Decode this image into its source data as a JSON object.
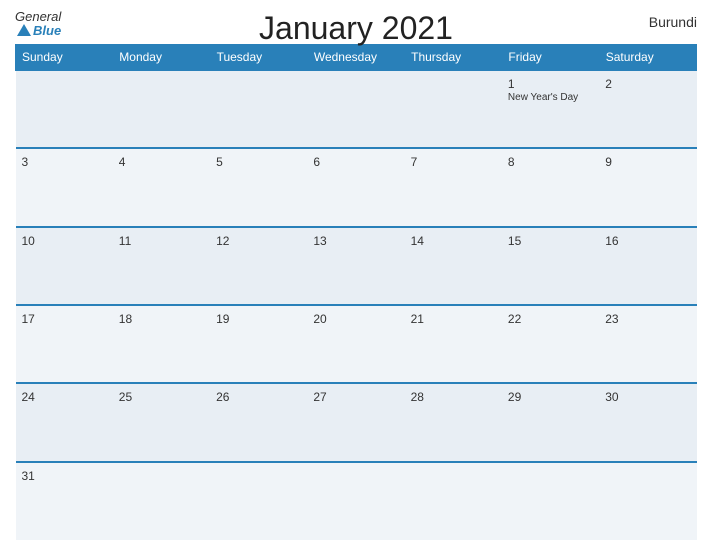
{
  "header": {
    "logo_general": "General",
    "logo_blue": "Blue",
    "title": "January 2021",
    "country": "Burundi"
  },
  "days_of_week": [
    "Sunday",
    "Monday",
    "Tuesday",
    "Wednesday",
    "Thursday",
    "Friday",
    "Saturday"
  ],
  "weeks": [
    [
      {
        "day": "",
        "event": ""
      },
      {
        "day": "",
        "event": ""
      },
      {
        "day": "",
        "event": ""
      },
      {
        "day": "",
        "event": ""
      },
      {
        "day": "",
        "event": ""
      },
      {
        "day": "1",
        "event": "New Year's Day"
      },
      {
        "day": "2",
        "event": ""
      }
    ],
    [
      {
        "day": "3",
        "event": ""
      },
      {
        "day": "4",
        "event": ""
      },
      {
        "day": "5",
        "event": ""
      },
      {
        "day": "6",
        "event": ""
      },
      {
        "day": "7",
        "event": ""
      },
      {
        "day": "8",
        "event": ""
      },
      {
        "day": "9",
        "event": ""
      }
    ],
    [
      {
        "day": "10",
        "event": ""
      },
      {
        "day": "11",
        "event": ""
      },
      {
        "day": "12",
        "event": ""
      },
      {
        "day": "13",
        "event": ""
      },
      {
        "day": "14",
        "event": ""
      },
      {
        "day": "15",
        "event": ""
      },
      {
        "day": "16",
        "event": ""
      }
    ],
    [
      {
        "day": "17",
        "event": ""
      },
      {
        "day": "18",
        "event": ""
      },
      {
        "day": "19",
        "event": ""
      },
      {
        "day": "20",
        "event": ""
      },
      {
        "day": "21",
        "event": ""
      },
      {
        "day": "22",
        "event": ""
      },
      {
        "day": "23",
        "event": ""
      }
    ],
    [
      {
        "day": "24",
        "event": ""
      },
      {
        "day": "25",
        "event": ""
      },
      {
        "day": "26",
        "event": ""
      },
      {
        "day": "27",
        "event": ""
      },
      {
        "day": "28",
        "event": ""
      },
      {
        "day": "29",
        "event": ""
      },
      {
        "day": "30",
        "event": ""
      }
    ],
    [
      {
        "day": "31",
        "event": ""
      },
      {
        "day": "",
        "event": ""
      },
      {
        "day": "",
        "event": ""
      },
      {
        "day": "",
        "event": ""
      },
      {
        "day": "",
        "event": ""
      },
      {
        "day": "",
        "event": ""
      },
      {
        "day": "",
        "event": ""
      }
    ]
  ]
}
